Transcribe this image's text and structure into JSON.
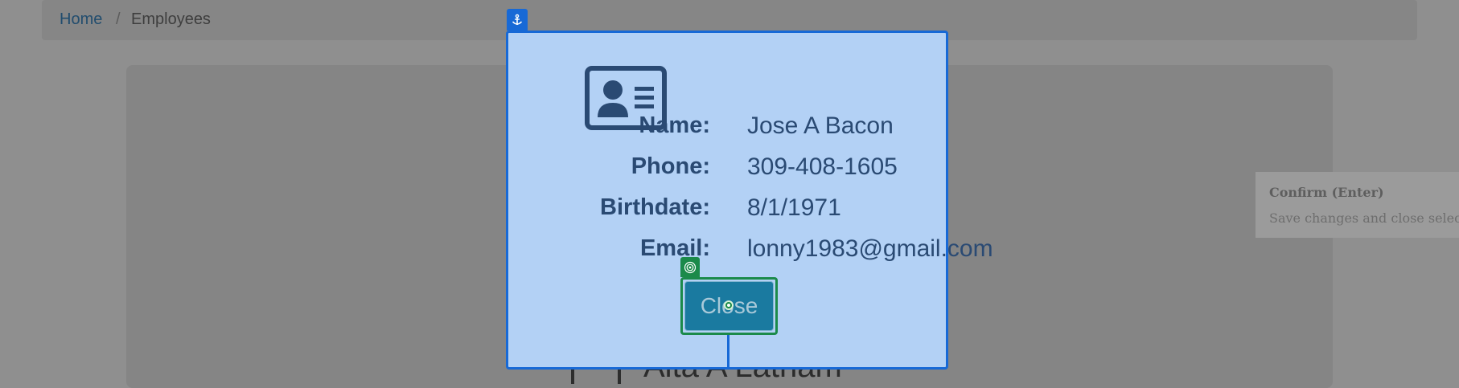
{
  "breadcrumb": {
    "home": "Home",
    "separator": "/",
    "current": "Employees"
  },
  "background_card": {
    "name": "Alta A Latham"
  },
  "tooltip": {
    "title": "Confirm (Enter)",
    "text": "Save changes and close select"
  },
  "modal": {
    "icon": "id-card-icon",
    "fields": [
      {
        "label": "Name:",
        "value": "Jose A Bacon"
      },
      {
        "label": "Phone:",
        "value": "309-408-1605"
      },
      {
        "label": "Birthdate:",
        "value": "8/1/1971"
      },
      {
        "label": "Email:",
        "value": "lonny1983@gmail.com"
      }
    ],
    "close_label": "Close"
  },
  "colors": {
    "overlay": "#8f8f8f",
    "modal_background": "#b3d1f5",
    "modal_highlight": "#1769d6",
    "close_highlight": "#1b8a4a",
    "close_button": "#1a7aa0",
    "text": "#2a4a73"
  }
}
